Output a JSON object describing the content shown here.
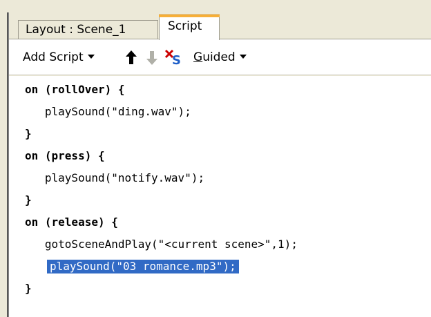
{
  "tabs": {
    "layout_label": "Layout : Scene_1",
    "script_label": "Script"
  },
  "toolbar": {
    "add_script_label": "Add Script",
    "up_icon": "up-arrow-icon",
    "down_icon": "down-arrow-icon",
    "delete_icon": "delete-script-icon",
    "guided_label_underlined": "G",
    "guided_label_rest": "uided"
  },
  "code": {
    "lines": [
      "on (rollOver) {",
      "   playSound(\"ding.wav\");",
      "}",
      "on (press) {",
      "   playSound(\"notify.wav\");",
      "}",
      "on (release) {",
      "   gotoSceneAndPlay(\"<current scene>\",1);",
      "playSound(\"03 romance.mp3\");",
      "}"
    ],
    "selected_line_index": 8
  },
  "colors": {
    "selection": "#316ac5",
    "active_tab_accent": "#f7b03a",
    "delete_icon_red": "#cc0000",
    "delete_icon_blue": "#1f5fc8"
  }
}
